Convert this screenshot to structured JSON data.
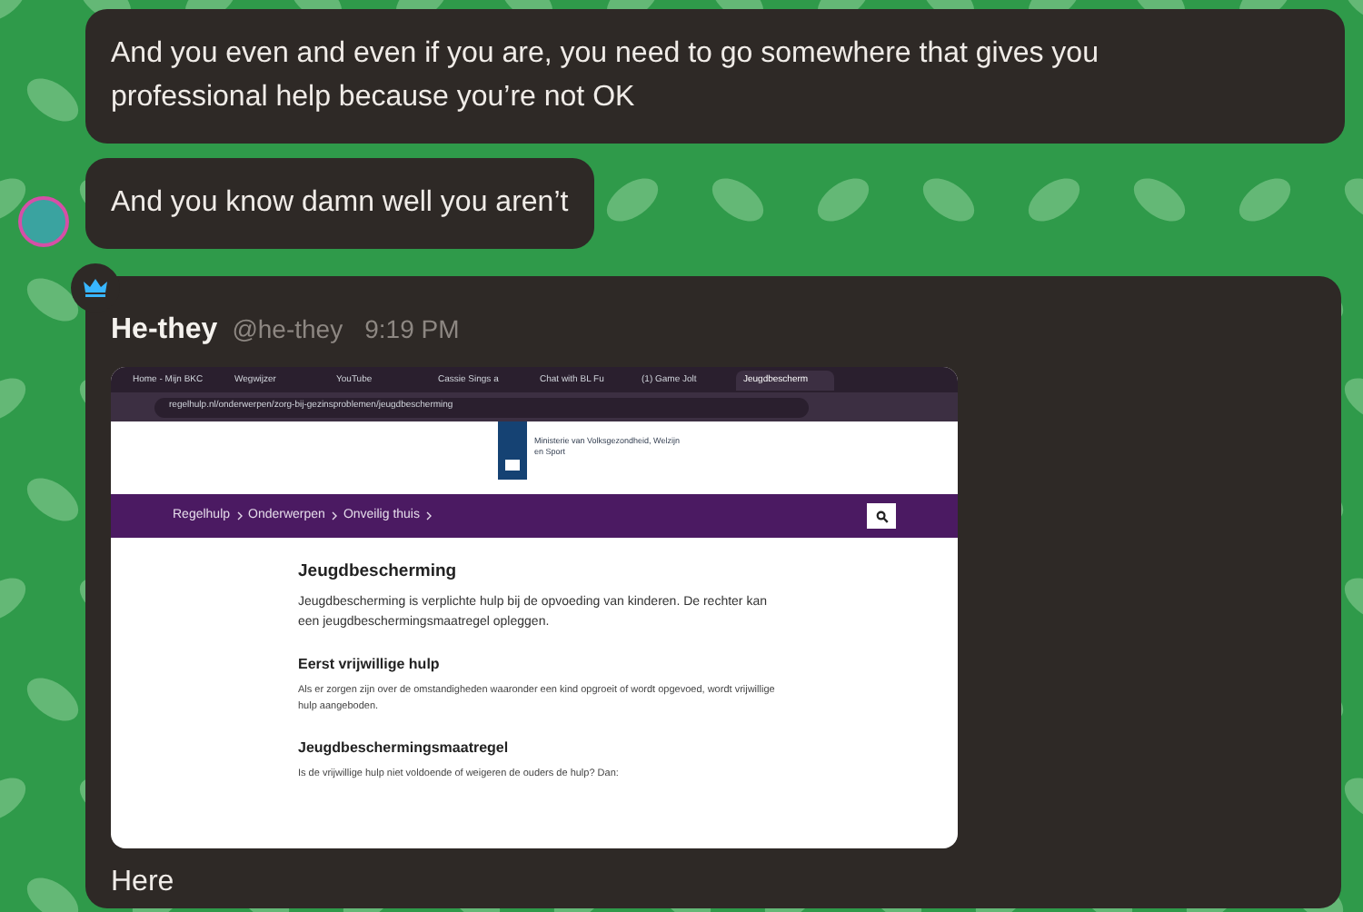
{
  "messages": [
    {
      "kind": "text",
      "text": "And you even and even if you are, you need to go somewhere that gives you professional help because you’re not OK"
    },
    {
      "kind": "text",
      "text": "And you know damn well you aren’t",
      "avatar": true
    }
  ],
  "post": {
    "author": "He-they",
    "handle": "@he-they",
    "time": "9:19 PM",
    "caption": "Here",
    "screenshot": {
      "tabs": [
        {
          "label": "Home - Mijn BKC",
          "selected": false
        },
        {
          "label": "Wegwijzer",
          "selected": false
        },
        {
          "label": "YouTube",
          "selected": false
        },
        {
          "label": "Cassie Sings a",
          "selected": false
        },
        {
          "label": "Chat with BL Fu",
          "selected": false
        },
        {
          "label": "(1) Game Jolt",
          "selected": false
        },
        {
          "label": "Jeugdbescherm",
          "selected": true
        }
      ],
      "url": "regelhulp.nl/onderwerpen/zorg-bij-gezinsproblemen/jeugdbescherming",
      "logo_text": "Ministerie van Volksgezondheid, Welzijn en Sport",
      "breadcrumbs": [
        "Regelhulp",
        "Onderwerpen",
        "Onveilig thuis"
      ],
      "title": "Jeugdbescherming",
      "intro": "Jeugdbescherming is verplichte hulp bij de opvoeding van kinderen. De rechter kan een jeugdbeschermingsmaatregel opleggen.",
      "sections": [
        {
          "heading": "Eerst vrijwillige hulp",
          "text": "Als er zorgen zijn over de omstandigheden waaronder een kind opgroeit of wordt opgevoed, wordt vrijwillige hulp aangeboden."
        },
        {
          "heading": "Jeugdbeschermingsmaatregel",
          "text": "Is de vrijwillige hulp niet voldoende of weigeren de ouders de hulp? Dan:"
        }
      ]
    }
  }
}
